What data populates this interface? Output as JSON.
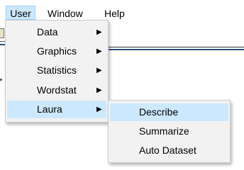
{
  "menubar": {
    "items": [
      {
        "label": "User",
        "state": "open"
      },
      {
        "label": "Window"
      },
      {
        "label": "Help"
      }
    ]
  },
  "user_menu": {
    "items": [
      {
        "label": "Data",
        "has_submenu": true
      },
      {
        "label": "Graphics",
        "has_submenu": true
      },
      {
        "label": "Statistics",
        "has_submenu": true
      },
      {
        "label": "Wordstat",
        "has_submenu": true
      },
      {
        "label": "Laura",
        "has_submenu": true,
        "highlighted": true
      }
    ],
    "arrow_glyph": "▶"
  },
  "laura_submenu": {
    "items": [
      {
        "label": "Describe",
        "highlighted": true
      },
      {
        "label": "Summarize"
      },
      {
        "label": "Auto Dataset"
      }
    ]
  },
  "colors": {
    "highlight": "#cce8ff",
    "menu_bg": "#f2f2f2",
    "menu_border": "#cccccc"
  }
}
